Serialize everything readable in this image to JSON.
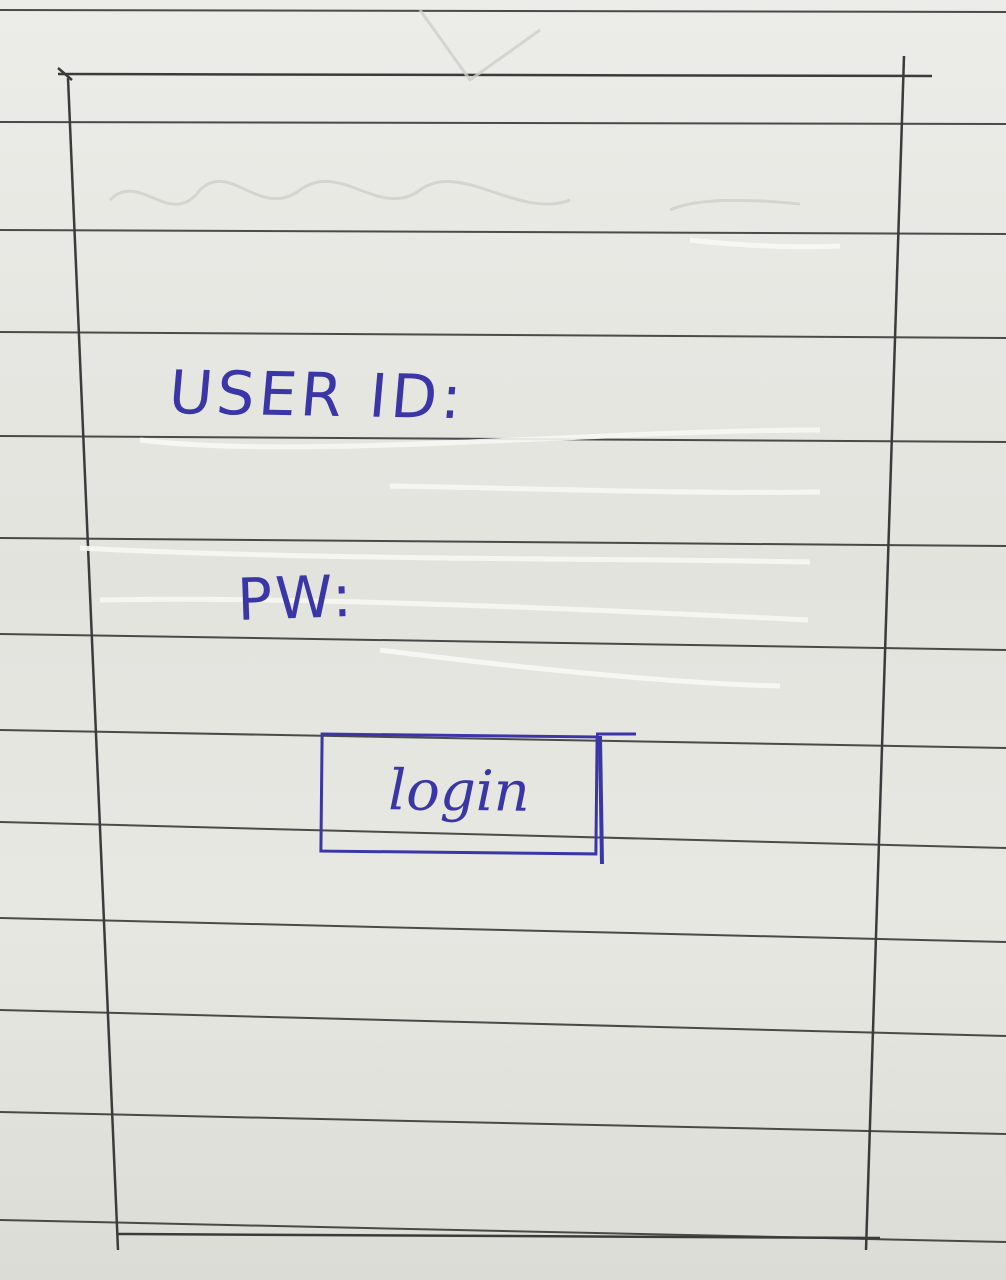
{
  "colors": {
    "ink": "#3a36a8",
    "pencil": "#3b3b3b",
    "paper": "#e6e6e2",
    "rule": "#2f2f2f"
  },
  "form": {
    "user_id_label": "USER ID:",
    "pw_label": "PW:",
    "login_label": "login"
  }
}
